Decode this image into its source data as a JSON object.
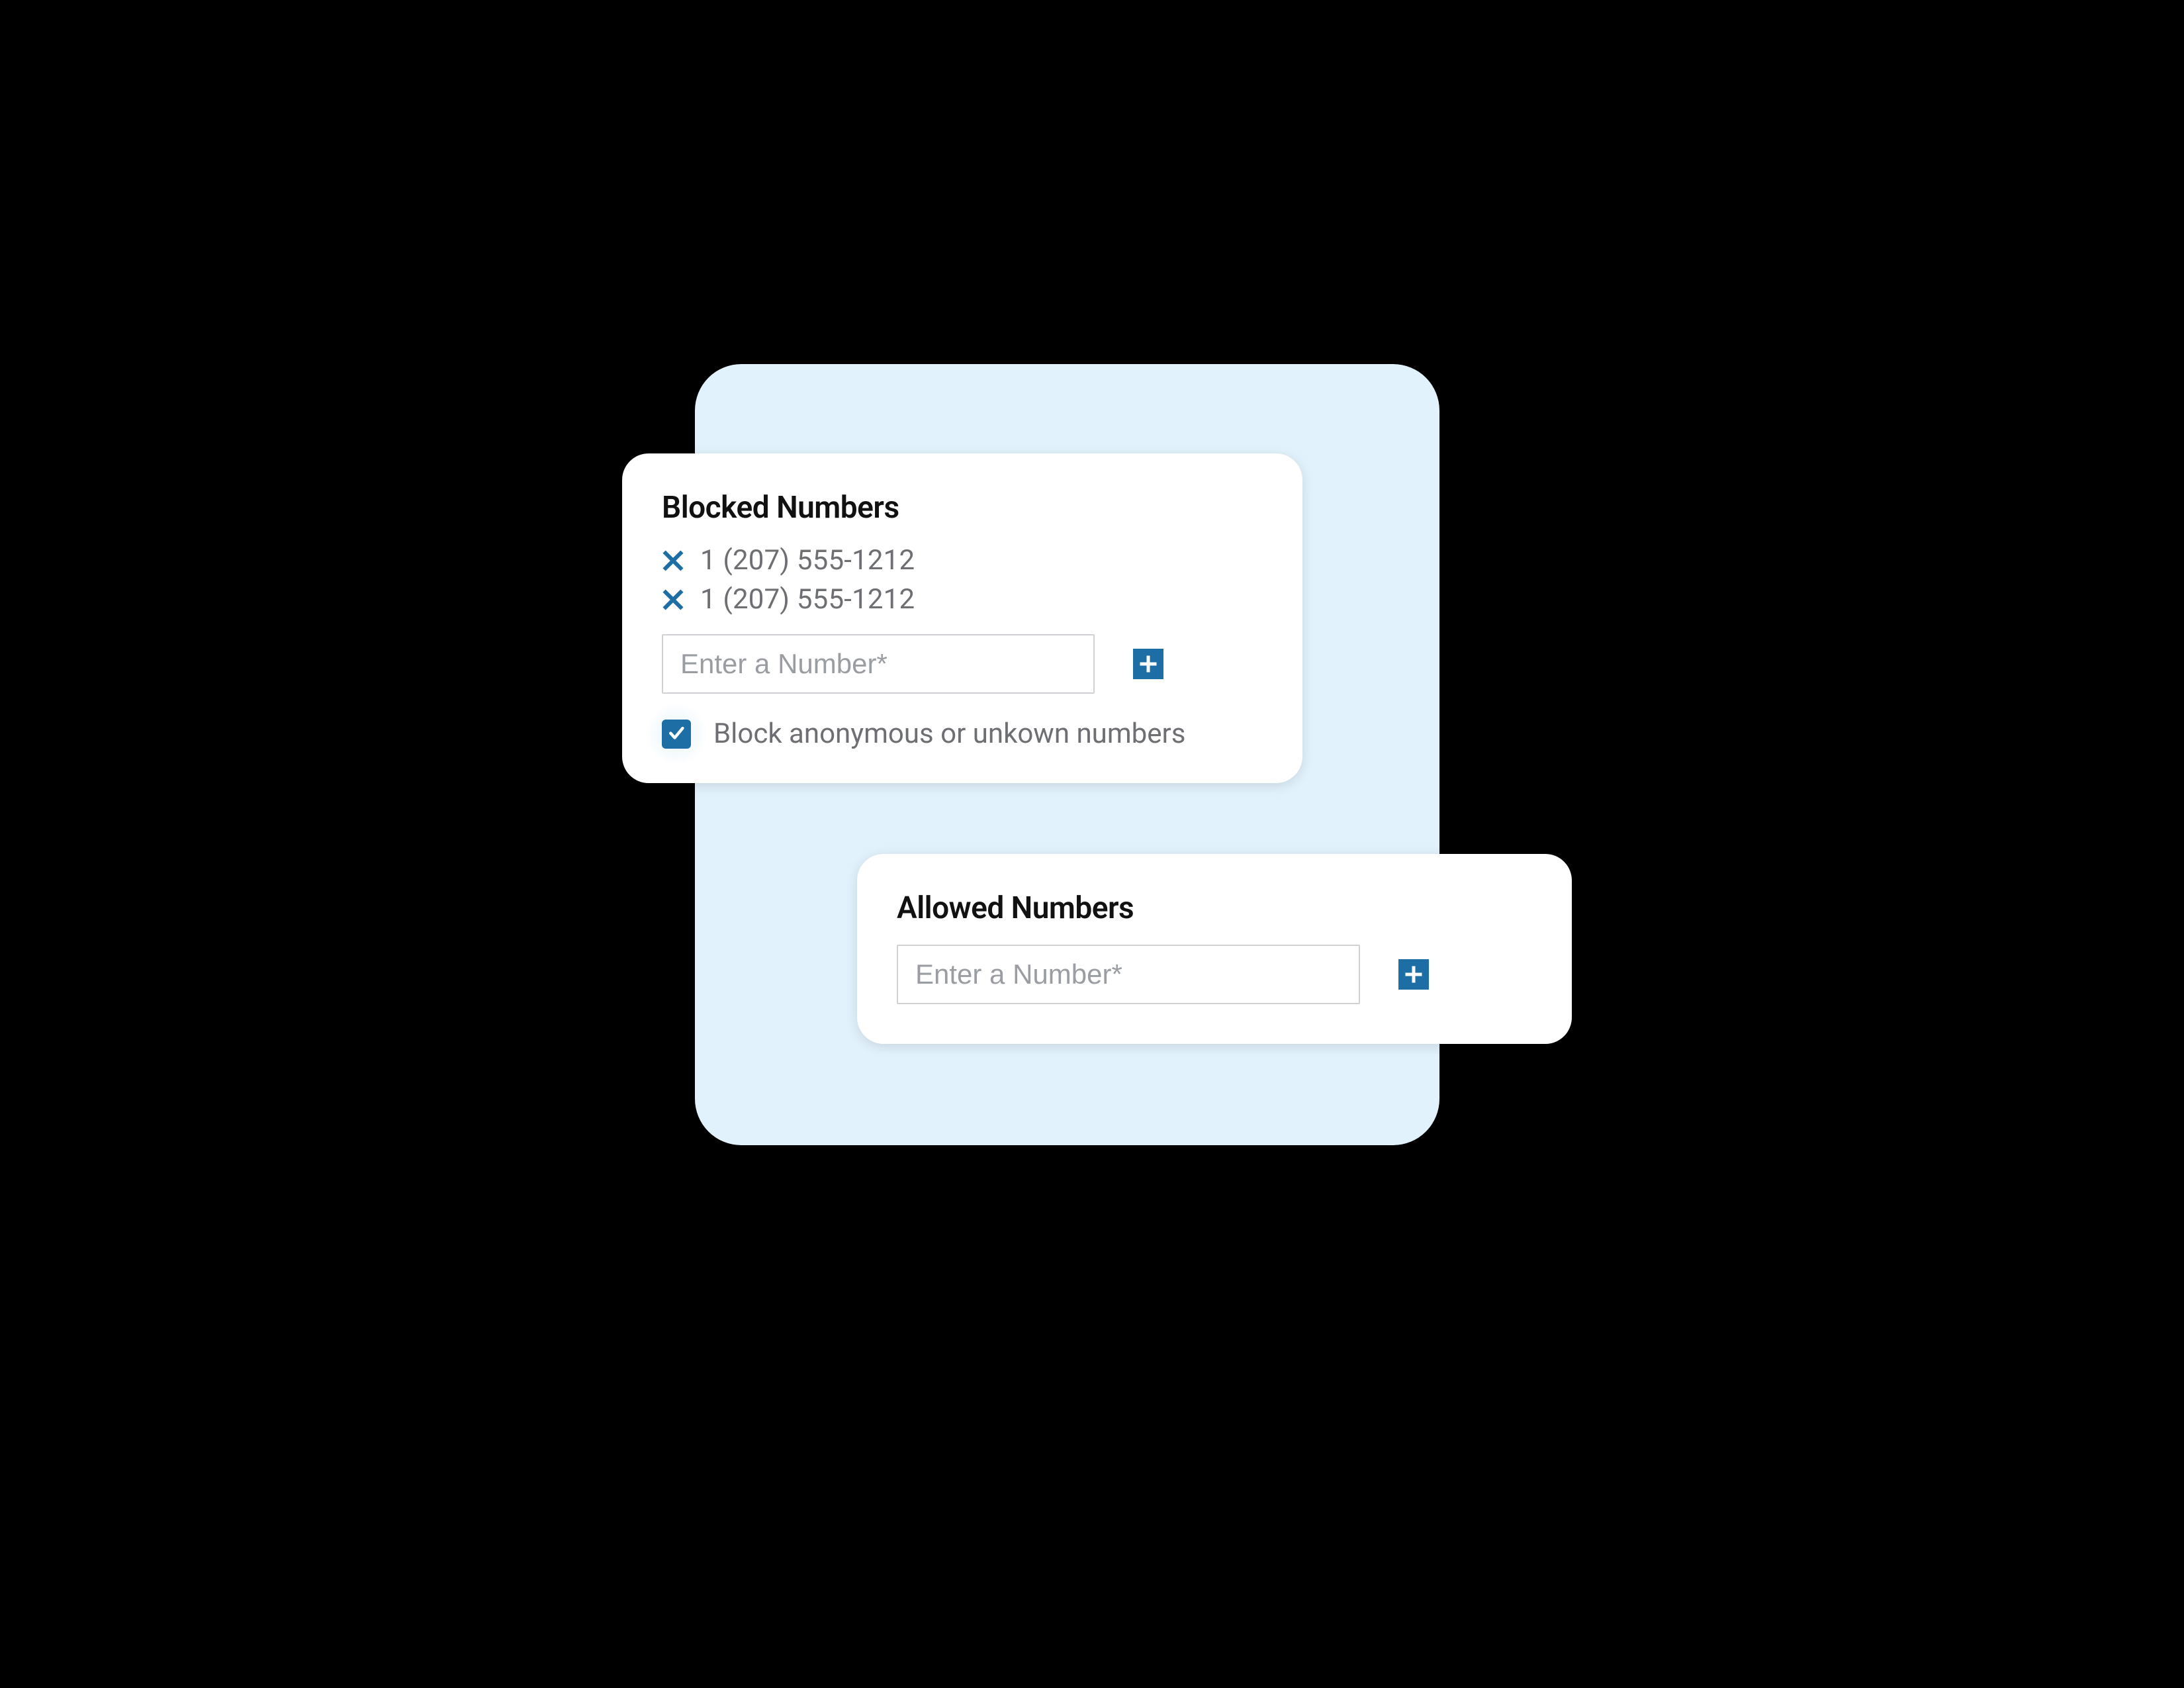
{
  "colors": {
    "accent": "#1c6ea4",
    "panel_bg": "#e2f2fc",
    "text_muted": "#6d6f73",
    "text_primary": "#111111"
  },
  "blocked": {
    "title": "Blocked Numbers",
    "numbers": [
      "1 (207) 555-1212",
      "1 (207) 555-1212"
    ],
    "input_placeholder": "Enter a Number*",
    "block_anon_checked": true,
    "block_anon_label": "Block anonymous or unkown numbers"
  },
  "allowed": {
    "title": "Allowed Numbers",
    "input_placeholder": "Enter a Number*"
  }
}
